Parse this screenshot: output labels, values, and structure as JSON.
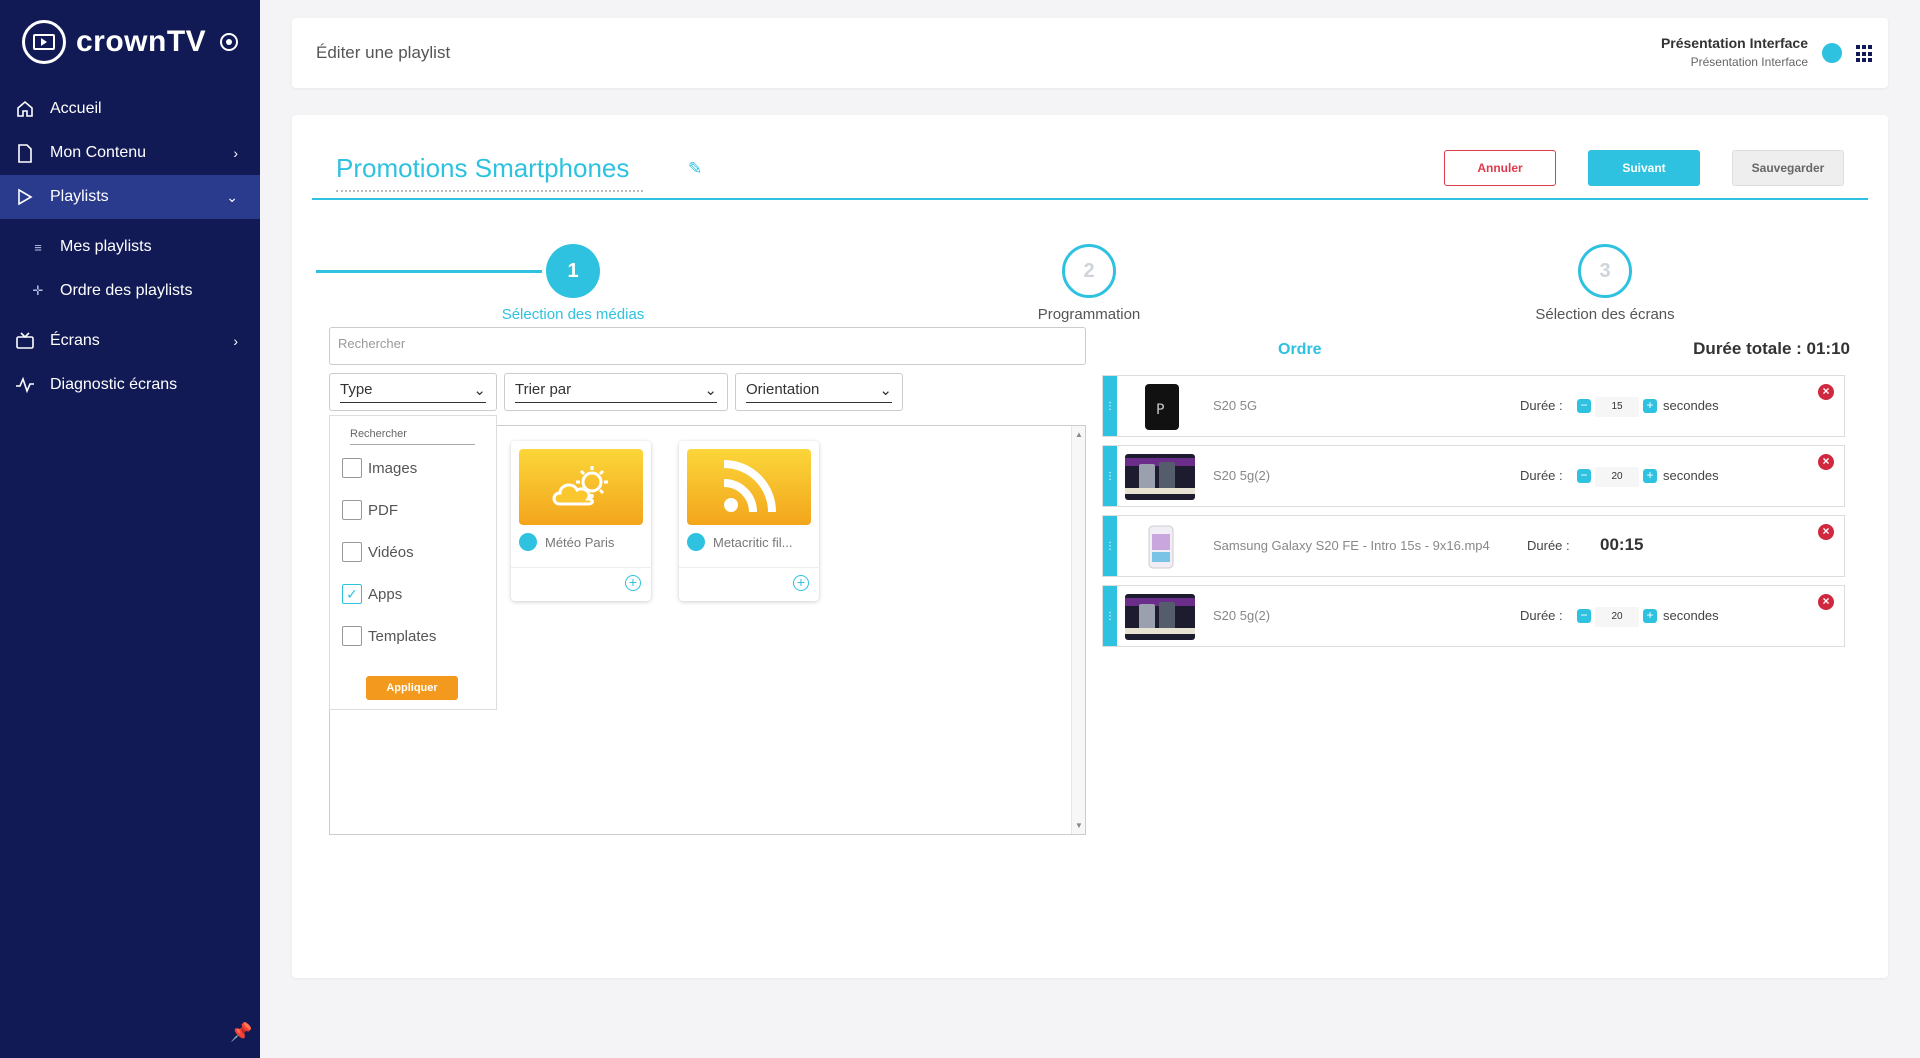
{
  "brand": {
    "name": "crownTV"
  },
  "sidebar": {
    "items": [
      {
        "label": "Accueil",
        "icon": "home-icon"
      },
      {
        "label": "Mon Contenu",
        "icon": "document-icon"
      },
      {
        "label": "Playlists",
        "icon": "play-icon"
      },
      {
        "label": "Écrans",
        "icon": "tv-icon"
      },
      {
        "label": "Diagnostic écrans",
        "icon": "pulse-icon"
      }
    ],
    "subitems": [
      {
        "label": "Mes playlists"
      },
      {
        "label": "Ordre des playlists"
      }
    ]
  },
  "header": {
    "page_title": "Éditer une playlist",
    "user_name": "Présentation Interface",
    "user_sub": "Présentation Interface"
  },
  "playlist": {
    "title": "Promotions Smartphones"
  },
  "actions": {
    "cancel": "Annuler",
    "next": "Suivant",
    "save": "Sauvegarder"
  },
  "steps": [
    {
      "number": "1",
      "label": "Sélection des médias",
      "state": "active"
    },
    {
      "number": "2",
      "label": "Programmation",
      "state": "todo"
    },
    {
      "number": "3",
      "label": "Sélection des écrans",
      "state": "todo"
    }
  ],
  "media": {
    "search_placeholder": "Rechercher",
    "dropdowns": {
      "type": "Type",
      "sort": "Trier par",
      "orientation": "Orientation"
    },
    "filter": {
      "search_label": "Rechercher",
      "options": [
        {
          "label": "Images",
          "checked": false
        },
        {
          "label": "PDF",
          "checked": false
        },
        {
          "label": "Vidéos",
          "checked": false
        },
        {
          "label": "Apps",
          "checked": true
        },
        {
          "label": "Templates",
          "checked": false
        }
      ],
      "apply": "Appliquer"
    },
    "cards": [
      {
        "name": "Météo Paris",
        "icon": "weather-icon"
      },
      {
        "name": "Metacritic fil...",
        "icon": "rss-icon"
      }
    ]
  },
  "order": {
    "title": "Ordre",
    "total": "Durée totale : 01:10",
    "duration_label": "Durée :",
    "seconds_label": "secondes",
    "rows": [
      {
        "name": "S20 5G",
        "type": "image",
        "value": "15"
      },
      {
        "name": "S20 5g(2)",
        "type": "image",
        "value": "20"
      },
      {
        "name": "Samsung Galaxy S20 FE - Intro 15s - 9x16.mp4",
        "type": "video",
        "time": "00:15"
      },
      {
        "name": "S20 5g(2)",
        "type": "image",
        "value": "20"
      }
    ]
  },
  "colors": {
    "sidebar": "#111a55",
    "accent": "#2ec2e0",
    "danger": "#e03b4b",
    "apply": "#f39a1e"
  }
}
